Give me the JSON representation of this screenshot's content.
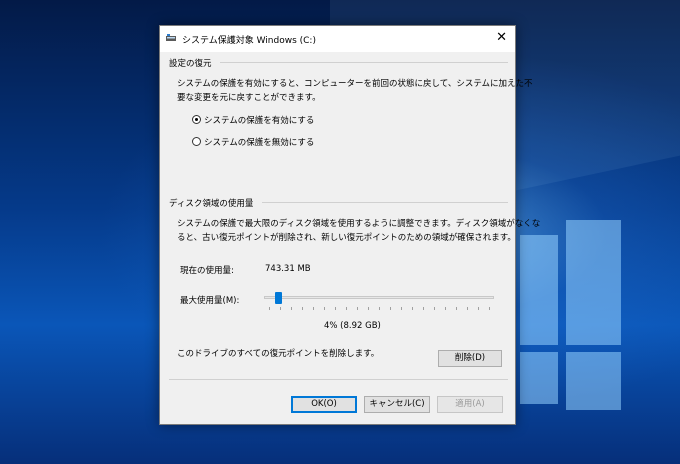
{
  "window": {
    "title": "システム保護対象 Windows (C:)",
    "close_glyph": "✕"
  },
  "restore_settings": {
    "group_label": "設定の復元",
    "description_line1": "システムの保護を有効にすると、コンピューターを前回の状態に戻して、システムに加えた不",
    "description_line2": "要な変更を元に戻すことができます。",
    "option_enable": "システムの保護を有効にする",
    "option_disable": "システムの保護を無効にする",
    "selected": "enable"
  },
  "disk_usage": {
    "group_label": "ディスク領域の使用量",
    "description_line1": "システムの保護で最大限のディスク領域を使用するように調整できます。ディスク領域がなくな",
    "description_line2": "ると、古い復元ポイントが削除され、新しい復元ポイントのための領域が確保されます。",
    "current_label": "現在の使用量:",
    "current_value": "743.31 MB",
    "max_label": "最大使用量(M):",
    "slider_value_text": "4% (8.92 GB)",
    "slider_percent": 4,
    "delete_text": "このドライブのすべての復元ポイントを削除します。",
    "delete_button": "削除(D)"
  },
  "buttons": {
    "ok": "OK(O)",
    "cancel": "キャンセル(C)",
    "apply": "適用(A)"
  },
  "colors": {
    "accent": "#0078d7",
    "dialog_bg": "#f0f0f0"
  }
}
